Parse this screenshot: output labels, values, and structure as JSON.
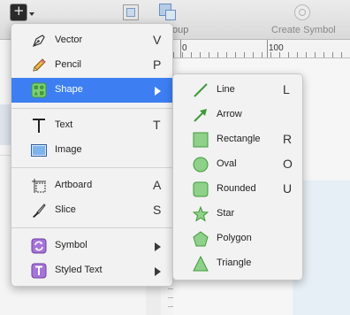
{
  "toolbar": {
    "group_label": "oup",
    "create_symbol_label": "Create Symbol"
  },
  "ruler": {
    "labels": [
      "0",
      "100"
    ]
  },
  "insert_menu": {
    "items": [
      {
        "label": "Vector",
        "shortcut": "V",
        "icon": "vector-pen-icon"
      },
      {
        "label": "Pencil",
        "shortcut": "P",
        "icon": "pencil-icon"
      },
      {
        "label": "Shape",
        "shortcut": "",
        "icon": "shape-grid-icon",
        "submenu": true,
        "active": true
      },
      {
        "label": "Text",
        "shortcut": "T",
        "icon": "text-icon"
      },
      {
        "label": "Image",
        "shortcut": "",
        "icon": "image-icon"
      },
      {
        "label": "Artboard",
        "shortcut": "A",
        "icon": "artboard-icon"
      },
      {
        "label": "Slice",
        "shortcut": "S",
        "icon": "slice-knife-icon"
      },
      {
        "label": "Symbol",
        "shortcut": "",
        "icon": "symbol-icon",
        "submenu": true
      },
      {
        "label": "Styled Text",
        "shortcut": "",
        "icon": "styled-text-icon",
        "submenu": true
      }
    ]
  },
  "shape_submenu": {
    "items": [
      {
        "label": "Line",
        "shortcut": "L",
        "icon": "line-icon"
      },
      {
        "label": "Arrow",
        "shortcut": "",
        "icon": "arrow-icon"
      },
      {
        "label": "Rectangle",
        "shortcut": "R",
        "icon": "rectangle-icon"
      },
      {
        "label": "Oval",
        "shortcut": "O",
        "icon": "oval-icon"
      },
      {
        "label": "Rounded",
        "shortcut": "U",
        "icon": "rounded-rectangle-icon"
      },
      {
        "label": "Star",
        "shortcut": "",
        "icon": "star-icon"
      },
      {
        "label": "Polygon",
        "shortcut": "",
        "icon": "polygon-icon"
      },
      {
        "label": "Triangle",
        "shortcut": "",
        "icon": "triangle-icon"
      }
    ]
  },
  "colors": {
    "highlight": "#3d7ff2",
    "shape_fill": "#8fd18a",
    "shape_stroke": "#3f9a3a",
    "symbol_purple": "#a574d8"
  }
}
